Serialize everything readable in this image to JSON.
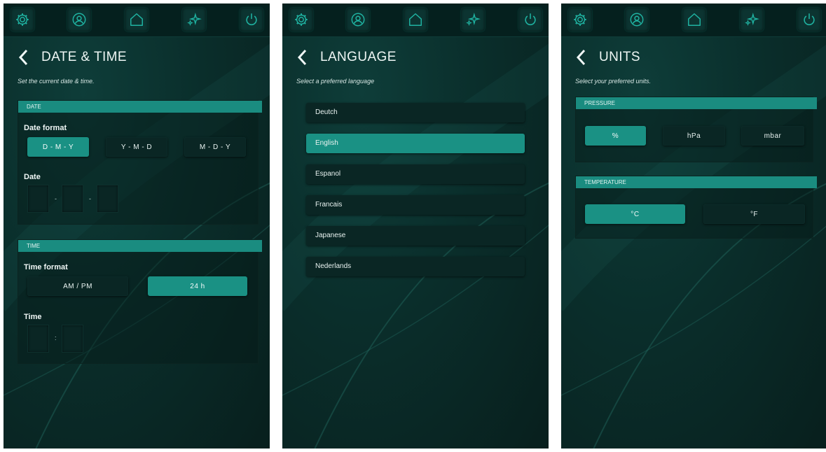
{
  "colors": {
    "accent": "#1a9184",
    "background": "#0a2e2b",
    "panel_border": "#0b2320"
  },
  "topbar_icons": [
    "gear-icon",
    "user-icon",
    "home-icon",
    "sparkle-icon",
    "power-icon"
  ],
  "screens": {
    "date_time": {
      "title": "DATE & TIME",
      "subtitle": "Set the current date & time.",
      "date_section": {
        "header": "DATE",
        "format_label": "Date format",
        "formats": [
          "D - M - Y",
          "Y - M - D",
          "M - D - Y"
        ],
        "selected_format": "D - M - Y",
        "date_label": "Date",
        "date_separator": "-"
      },
      "time_section": {
        "header": "TIME",
        "format_label": "Time format",
        "formats": [
          "AM / PM",
          "24 h"
        ],
        "selected_format": "24 h",
        "time_label": "Time",
        "time_separator": ":"
      }
    },
    "language": {
      "title": "LANGUAGE",
      "subtitle": "Select a preferred language",
      "options": [
        "Deutch",
        "English",
        "Espanol",
        "Francais",
        "Japanese",
        "Nederlands"
      ],
      "selected": "English"
    },
    "units": {
      "title": "UNITS",
      "subtitle": "Select your preferred units.",
      "pressure": {
        "header": "PRESSURE",
        "options": [
          "%",
          "hPa",
          "mbar"
        ],
        "selected": "%"
      },
      "temperature": {
        "header": "TEMPERATURE",
        "options": [
          "°C",
          "°F"
        ],
        "selected": "°C"
      }
    }
  }
}
